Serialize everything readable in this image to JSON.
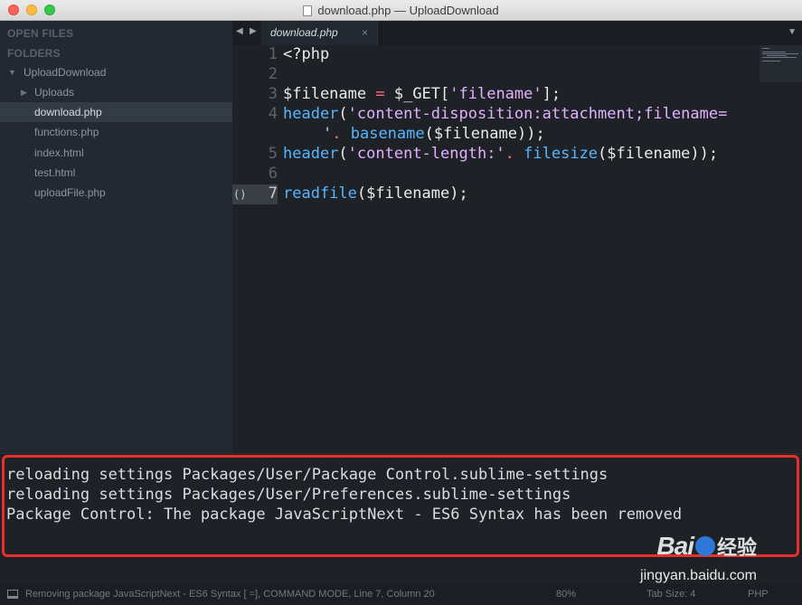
{
  "window": {
    "title": "download.php — UploadDownload"
  },
  "sidebar": {
    "open_files_label": "OPEN FILES",
    "folders_label": "FOLDERS",
    "project": "UploadDownload",
    "items": [
      {
        "label": "Uploads",
        "type": "folder"
      },
      {
        "label": "download.php",
        "type": "file",
        "active": true
      },
      {
        "label": "functions.php",
        "type": "file"
      },
      {
        "label": "index.html",
        "type": "file"
      },
      {
        "label": "test.html",
        "type": "file"
      },
      {
        "label": "uploadFile.php",
        "type": "file"
      }
    ]
  },
  "tabs": [
    {
      "label": "download.php",
      "close": "×"
    }
  ],
  "editor": {
    "line_numbers": [
      "1",
      "2",
      "3",
      "4",
      "5",
      "6",
      "7"
    ],
    "fold_marker": "()",
    "current_line": 7,
    "code": {
      "l1": "<?php",
      "l3_var": "$filename",
      "l3_eq": " = ",
      "l3_get": "$_GET[",
      "l3_key": "'filename'",
      "l3_end": "];",
      "l4_fn": "header",
      "l4_paren": "(",
      "l4_str": "'content-disposition:attachment;filename=",
      "l4b_str": "'",
      "l4b_dot": ". ",
      "l4b_fn": "basename",
      "l4b_rest": "($filename));",
      "l5_fn": "header",
      "l5_paren": "(",
      "l5_str": "'content-length:'",
      "l5_dot": ". ",
      "l5_fn2": "filesize",
      "l5_rest": "($filename));",
      "l7_fn": "readfile",
      "l7_rest": "($filename);"
    }
  },
  "console": {
    "lines": [
      "reloading settings Packages/User/Package Control.sublime-settings",
      "reloading settings Packages/User/Preferences.sublime-settings",
      "Package Control: The package JavaScriptNext - ES6 Syntax has been removed"
    ]
  },
  "status": {
    "message": "Removing package JavaScriptNext - ES6 Syntax [      =], COMMAND MODE, Line 7, Column 20",
    "zoom": "80%",
    "tab_size": "Tab Size: 4",
    "syntax": "PHP"
  },
  "watermark": {
    "brand_left": "Bai",
    "brand_right": "经验",
    "url": "jingyan.baidu.com"
  },
  "colors": {
    "highlight_box": "#e8302a",
    "function": "#56b6ff",
    "string": "#e2b0ff"
  }
}
